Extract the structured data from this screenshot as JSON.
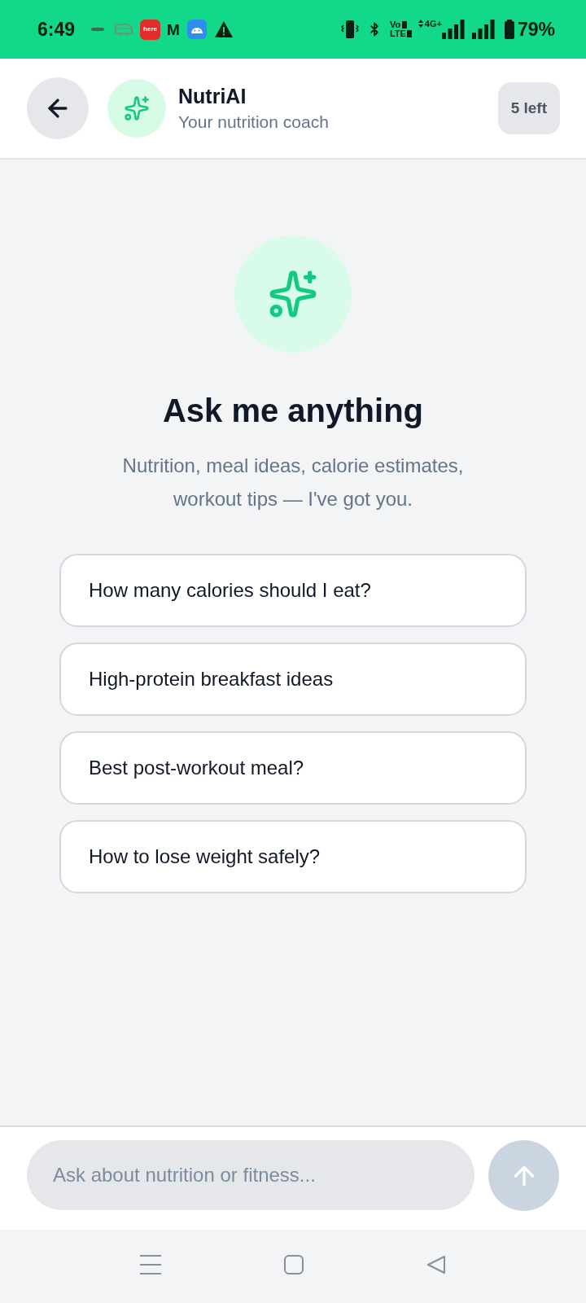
{
  "status_bar": {
    "time": "6:49",
    "app_tile_text": "here",
    "app_letter": "M",
    "volte": [
      "Vo",
      "LTE"
    ],
    "data_type": "4G+",
    "battery": "79%"
  },
  "header": {
    "title": "NutriAI",
    "subtitle": "Your nutrition coach",
    "quota": "5 left"
  },
  "welcome": {
    "title": "Ask me anything",
    "subtitle_lines": [
      "Nutrition, meal ideas, calorie estimates,",
      "workout tips — I've got you."
    ]
  },
  "suggestions": [
    "How many calories should I eat?",
    "High-protein breakfast ideas",
    "Best post-workout meal?",
    "How to lose weight safely?"
  ],
  "composer": {
    "placeholder": "Ask about nutrition or fitness...",
    "send_disabled": true
  }
}
